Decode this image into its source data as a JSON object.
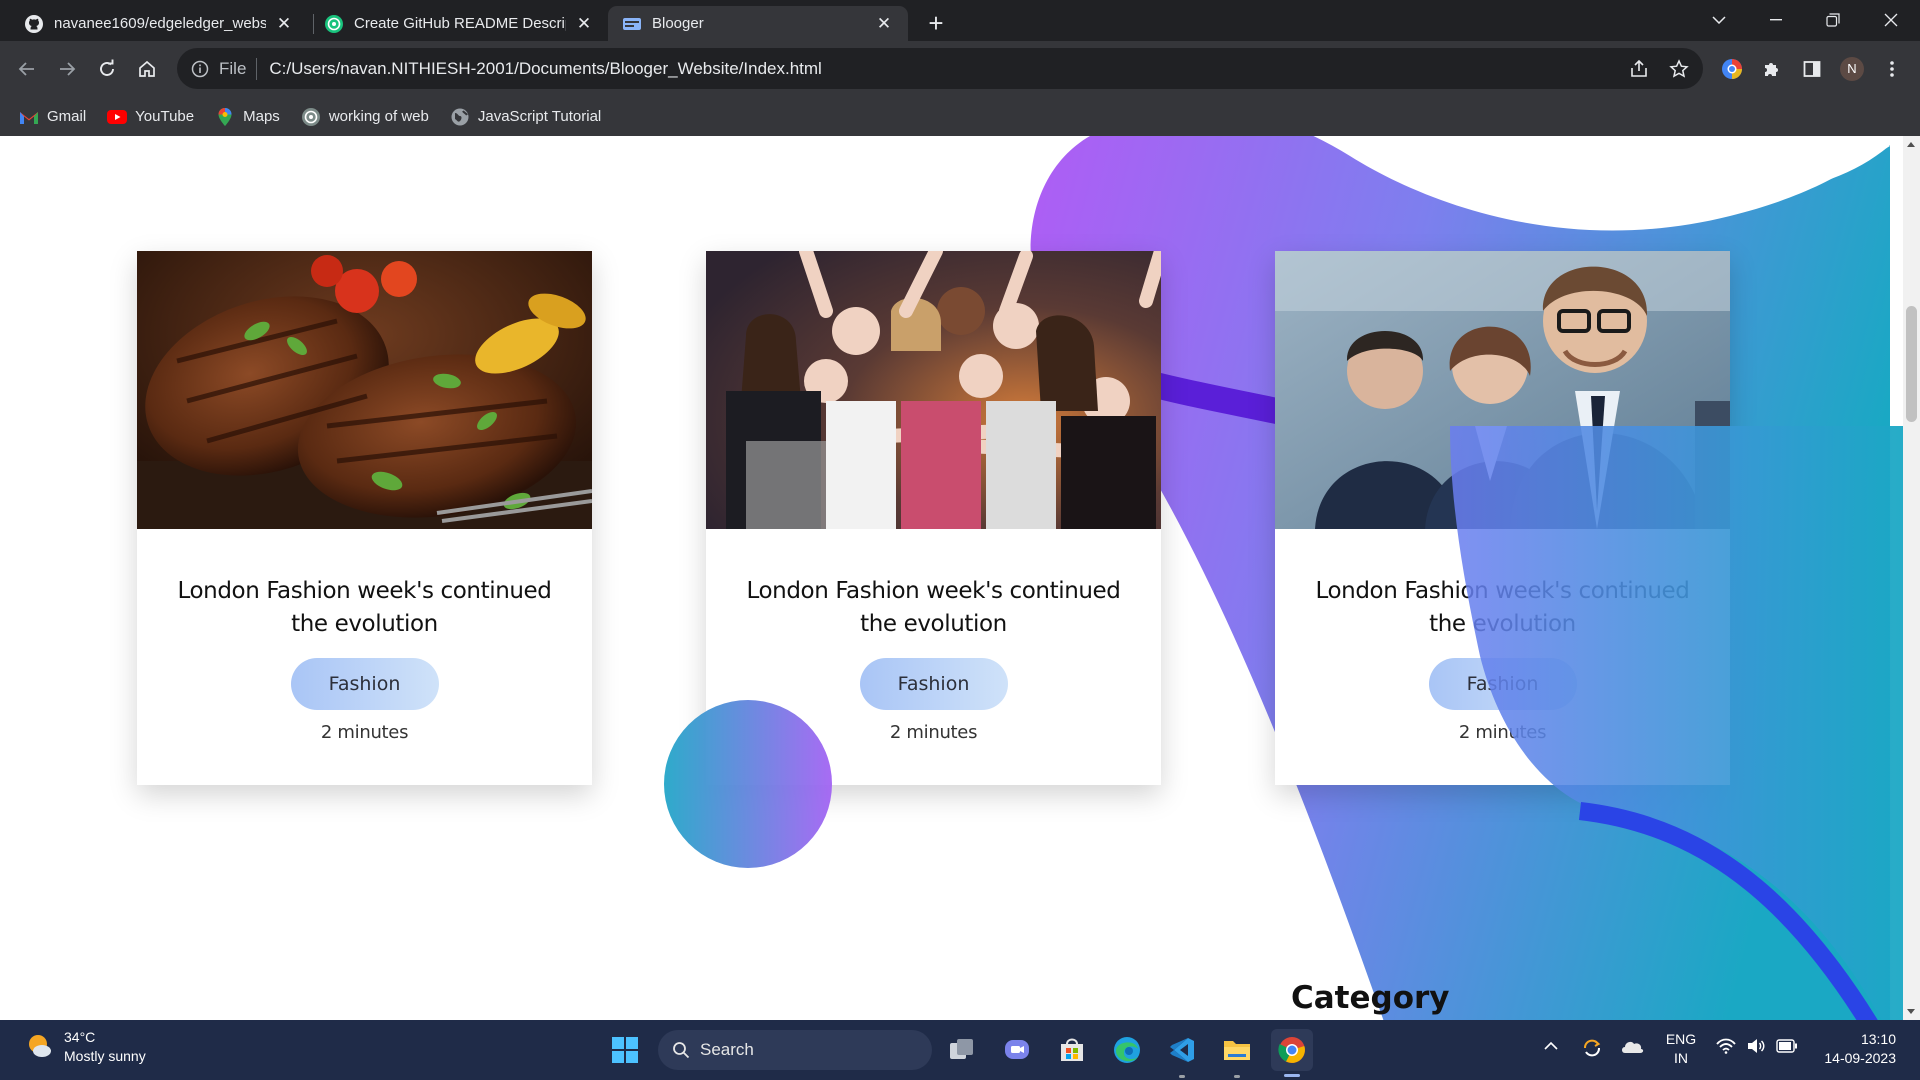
{
  "browser": {
    "tabs": [
      {
        "title": "navanee1609/edgeledger_websi",
        "icon": "github-icon",
        "active": false
      },
      {
        "title": "Create GitHub README Descript",
        "icon": "chatgpt-icon",
        "active": false
      },
      {
        "title": "Blooger",
        "icon": "blooger-favicon",
        "active": true
      }
    ],
    "url_scheme": "File",
    "url": "C:/Users/navan.NITHIESH-2001/Documents/Blooger_Website/Index.html",
    "profile_initial": "N",
    "bookmarks": [
      {
        "label": "Gmail",
        "icon": "gmail-icon"
      },
      {
        "label": "YouTube",
        "icon": "youtube-icon"
      },
      {
        "label": "Maps",
        "icon": "maps-icon"
      },
      {
        "label": "working of web",
        "icon": "chatgpt-icon"
      },
      {
        "label": "JavaScript Tutorial",
        "icon": "globe-icon"
      }
    ]
  },
  "page": {
    "cards": [
      {
        "title": "London Fashion week's continued the evolution",
        "tag": "Fashion",
        "read_time": "2 minutes",
        "image": "steak-photo"
      },
      {
        "title": "London Fashion week's continued the evolution",
        "tag": "Fashion",
        "read_time": "2 minutes",
        "image": "party-photo"
      },
      {
        "title": "London Fashion week's continued the evolution",
        "tag": "Fashion",
        "read_time": "2 minutes",
        "image": "business-photo"
      }
    ],
    "section_heading": "Category",
    "accent_gradient": [
      "#a364f3",
      "#23a6c8"
    ]
  },
  "taskbar": {
    "weather_temp": "34°C",
    "weather_desc": "Mostly sunny",
    "search_label": "Search",
    "lang_top": "ENG",
    "lang_bottom": "IN",
    "time": "13:10",
    "date": "14-09-2023"
  }
}
